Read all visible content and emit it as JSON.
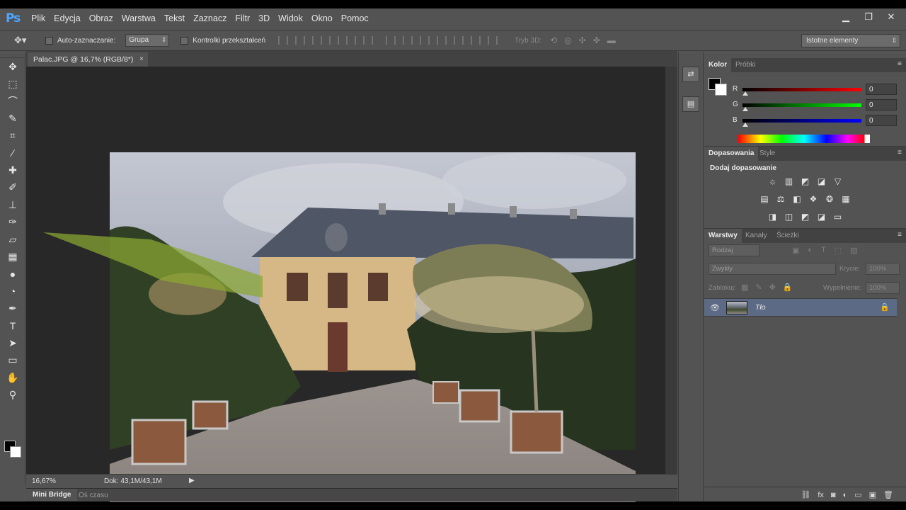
{
  "app": {
    "logo": "Ps"
  },
  "menu": [
    "Plik",
    "Edycja",
    "Obraz",
    "Warstwa",
    "Tekst",
    "Zaznacz",
    "Filtr",
    "3D",
    "Widok",
    "Okno",
    "Pomoc"
  ],
  "window_controls": {
    "minimize": "▁",
    "restore": "❐",
    "close": "✕"
  },
  "options": {
    "auto_select_label": "Auto-zaznaczanie:",
    "auto_select_value": "Grupa",
    "transform_label": "Kontrolki przekształceń",
    "mode_3d_label": "Tryb 3D:",
    "workspace": "Istotne elementy"
  },
  "document": {
    "tab_title": "Palac.JPG @ 16,7% (RGB/8*)",
    "tab_close": "×",
    "zoom": "16,67%",
    "doc_info": "Dok: 43,1M/43,1M",
    "status_arrow": "▶"
  },
  "bridge": {
    "tab_active": "Mini Bridge",
    "tab_other": "Oś czasu"
  },
  "tools": [
    {
      "name": "move-tool",
      "glyph": "✥"
    },
    {
      "name": "marquee-tool",
      "glyph": "⬚"
    },
    {
      "name": "lasso-tool",
      "glyph": "⌒"
    },
    {
      "name": "quick-select-tool",
      "glyph": "✎"
    },
    {
      "name": "crop-tool",
      "glyph": "⌗"
    },
    {
      "name": "eyedropper-tool",
      "glyph": "⁄"
    },
    {
      "name": "healing-tool",
      "glyph": "✚"
    },
    {
      "name": "brush-tool",
      "glyph": "✐"
    },
    {
      "name": "stamp-tool",
      "glyph": "⊥"
    },
    {
      "name": "history-brush-tool",
      "glyph": "✑"
    },
    {
      "name": "eraser-tool",
      "glyph": "▱"
    },
    {
      "name": "gradient-tool",
      "glyph": "▦"
    },
    {
      "name": "blur-tool",
      "glyph": "●"
    },
    {
      "name": "dodge-tool",
      "glyph": "◔"
    },
    {
      "name": "pen-tool",
      "glyph": "✒"
    },
    {
      "name": "type-tool",
      "glyph": "T"
    },
    {
      "name": "path-select-tool",
      "glyph": "➤"
    },
    {
      "name": "shape-tool",
      "glyph": "▭"
    },
    {
      "name": "hand-tool",
      "glyph": "✋"
    },
    {
      "name": "zoom-tool",
      "glyph": "⚲"
    }
  ],
  "color_panel": {
    "tab_active": "Kolor",
    "tab_other": "Próbki",
    "menu": "≡",
    "rows": [
      {
        "label": "R",
        "value": "0",
        "gradient": "linear-gradient(90deg,#000,#ff0000)"
      },
      {
        "label": "G",
        "value": "0",
        "gradient": "linear-gradient(90deg,#000,#00ff00)"
      },
      {
        "label": "B",
        "value": "0",
        "gradient": "linear-gradient(90deg,#000,#0000ff)"
      }
    ]
  },
  "adjustments": {
    "tab_active": "Dopasowania",
    "tab_other": "Style",
    "menu": "≡",
    "title": "Dodaj dopasowanie",
    "rows": [
      [
        "☼",
        "▥",
        "◩",
        "◪",
        "▽"
      ],
      [
        "▤",
        "⚖",
        "◧",
        "❖",
        "❂",
        "▦"
      ],
      [
        "◨",
        "◫",
        "◩",
        "◪",
        "▭"
      ]
    ]
  },
  "layers": {
    "tab_active": "Warstwy",
    "tab_kanaly": "Kanały",
    "tab_sciezki": "Ścieżki",
    "menu": "≡",
    "filter": "Rodzaj",
    "filter_icons": [
      "▣",
      "◐",
      "T",
      "⬚",
      "▧"
    ],
    "blend_mode": "Zwykły",
    "opacity_label": "Krycie:",
    "opacity_value": "100%",
    "lock_label": "Zablokuj:",
    "lock_icons": [
      "▩",
      "✎",
      "✥",
      "🔒"
    ],
    "fill_label": "Wypełnienie:",
    "fill_value": "100%",
    "items": [
      {
        "name": "Tło",
        "visible_icon": "👁",
        "lock_icon": "🔒"
      }
    ],
    "bottom_icons": [
      "⛓",
      "fx",
      "◙",
      "◐",
      "▭",
      "▣",
      "🗑"
    ]
  },
  "mini_panels": [
    "⇄",
    "▤"
  ]
}
